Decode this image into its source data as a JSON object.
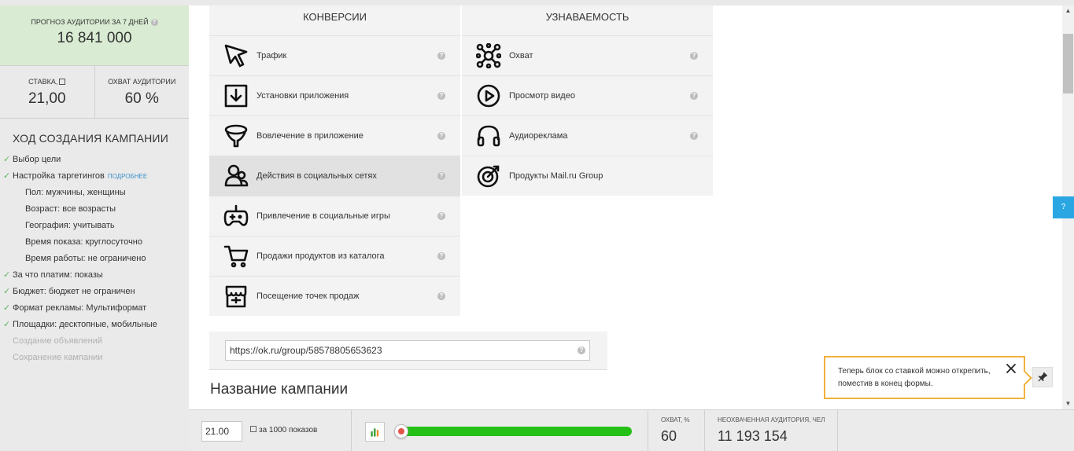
{
  "sidebar": {
    "forecast_label": "Прогноз аудитории за 7 дней",
    "forecast_value": "16 841 000",
    "bid_label": "Ставка,",
    "bid_value": "21,00",
    "reach_label": "Охват аудитории",
    "reach_value": "60 %",
    "progress_title": "Ход создания кампании",
    "more_link": "подробнее",
    "steps": [
      {
        "label": "Выбор цели",
        "done": true
      },
      {
        "label": "Настройка таргетингов",
        "done": true
      },
      {
        "label": "Пол: мужчины, женщины",
        "sub": true
      },
      {
        "label": "Возраст: все возрасты",
        "sub": true
      },
      {
        "label": "География: учитывать",
        "sub": true
      },
      {
        "label": "Время показа: круглосуточно",
        "sub": true
      },
      {
        "label": "Время работы: не ограничено",
        "sub": true
      },
      {
        "label": "За что платим: показы",
        "done": true
      },
      {
        "label": "Бюджет: бюджет не ограничен",
        "done": true
      },
      {
        "label": "Формат рекламы: Мультиформат",
        "done": true
      },
      {
        "label": "Площадки: десктопные, мобильные",
        "done": true
      },
      {
        "label": "Создание объявлений",
        "pending": true
      },
      {
        "label": "Сохранение кампании",
        "pending": true
      }
    ]
  },
  "objectives": {
    "conversions_title": "Конверсии",
    "awareness_title": "Узнаваемость",
    "conversions": [
      {
        "label": "Трафик",
        "icon": "cursor-icon"
      },
      {
        "label": "Установки приложения",
        "icon": "download-icon"
      },
      {
        "label": "Вовлечение в приложение",
        "icon": "funnel-icon"
      },
      {
        "label": "Действия в социальных сетях",
        "icon": "users-icon",
        "active": true
      },
      {
        "label": "Привлечение в социальные игры",
        "icon": "gamepad-icon"
      },
      {
        "label": "Продажи продуктов из каталога",
        "icon": "cart-icon"
      },
      {
        "label": "Посещение точек продаж",
        "icon": "store-icon"
      }
    ],
    "awareness": [
      {
        "label": "Охват",
        "icon": "network-icon"
      },
      {
        "label": "Просмотр видео",
        "icon": "play-icon"
      },
      {
        "label": "Аудиореклама",
        "icon": "headphones-icon"
      },
      {
        "label": "Продукты Mail.ru Group",
        "icon": "target-icon"
      }
    ]
  },
  "url_field": {
    "value": "https://ok.ru/group/58578805653623"
  },
  "campaign_name_title": "Название кампании",
  "tooltip": {
    "text": "Теперь блок со ставкой можно открепить, поместив в конец формы."
  },
  "help_tab": "?",
  "question_mark": "?",
  "bottom": {
    "bid_value": "21.00",
    "per_1000_label": "за 1000 показов",
    "slider_fill_percent": 100,
    "reach_label": "Охват, %",
    "reach_value": "60",
    "audience_label": "Неохваченная аудитория, чел",
    "audience_value": "11 193 154"
  },
  "colors": {
    "accent_green": "#24c016",
    "tooltip_border": "#f0b13c",
    "help_tab": "#2aa6e3",
    "check": "#5cb85c"
  }
}
